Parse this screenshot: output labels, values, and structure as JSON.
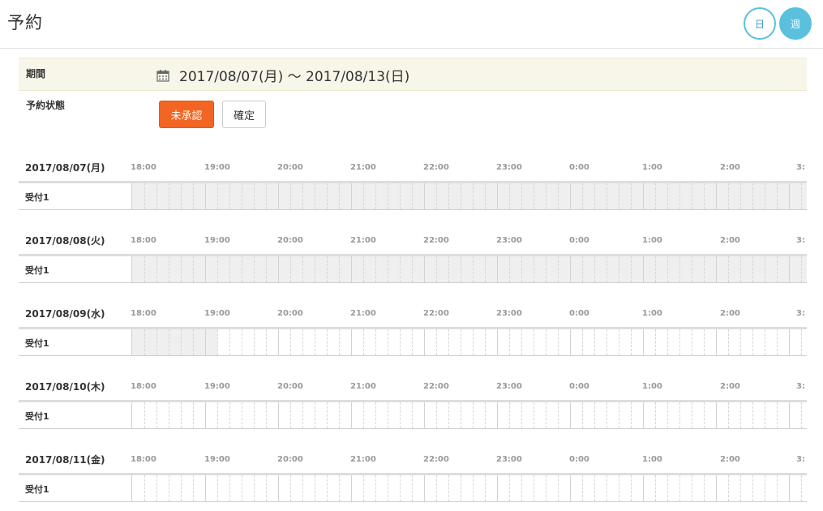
{
  "header": {
    "title": "予約",
    "day_button": "日",
    "week_button": "週"
  },
  "filter": {
    "period_label": "期間",
    "period_value": "2017/08/07(月) 〜 2017/08/13(日)",
    "status_label": "予約状態",
    "pending_label": "未承認",
    "confirmed_label": "確定"
  },
  "colors": {
    "accent": "#5bc0de",
    "pending": "#f26522",
    "period_bg": "#f8f6e8",
    "unavailable": "#efefef"
  },
  "hours": [
    "18:00",
    "19:00",
    "20:00",
    "21:00",
    "22:00",
    "23:00",
    "0:00",
    "1:00",
    "2:00",
    "3:"
  ],
  "days": [
    {
      "date": "2017/08/07(月)",
      "resource": "受付1",
      "unavailable_hours": 9.3
    },
    {
      "date": "2017/08/08(火)",
      "resource": "受付1",
      "unavailable_hours": 9.3
    },
    {
      "date": "2017/08/09(水)",
      "resource": "受付1",
      "unavailable_hours": 1.17
    },
    {
      "date": "2017/08/10(木)",
      "resource": "受付1",
      "unavailable_hours": 0
    },
    {
      "date": "2017/08/11(金)",
      "resource": "受付1",
      "unavailable_hours": 0
    }
  ]
}
